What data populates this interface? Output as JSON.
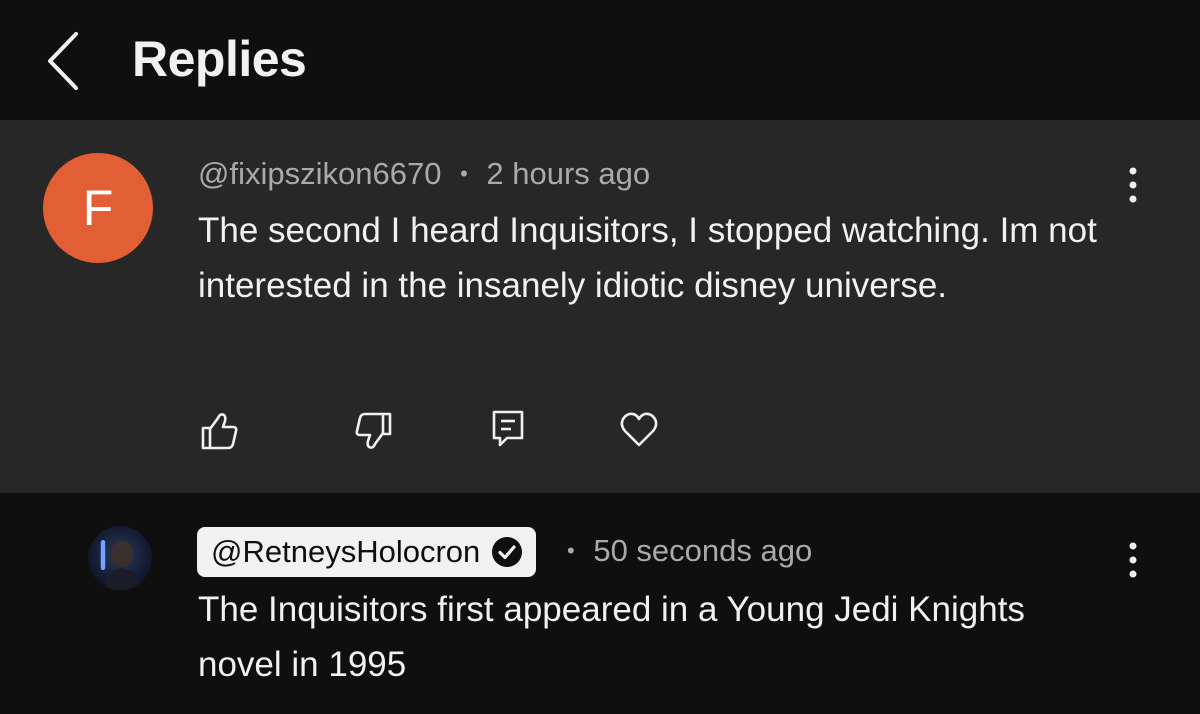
{
  "header": {
    "title": "Replies"
  },
  "parent_comment": {
    "avatar_letter": "F",
    "avatar_color": "#e25f35",
    "handle": "@fixipszikon6670",
    "separator": "•",
    "time": "2 hours ago",
    "text": "The second I heard Inquisitors, I stopped watching. Im not interested in the insanely idiotic disney universe.",
    "actions": [
      "like-icon",
      "dislike-icon",
      "reply-icon",
      "heart-icon"
    ]
  },
  "reply": {
    "handle": "@RetneysHolocron",
    "verified": true,
    "separator": "•",
    "time": "50 seconds ago",
    "text": "The Inquisitors first appeared in a Young Jedi Knights novel in 1995"
  },
  "colors": {
    "background": "#0f0f0f",
    "highlight": "#272727",
    "text": "#f1f1f1",
    "meta": "#aaaaaa"
  }
}
